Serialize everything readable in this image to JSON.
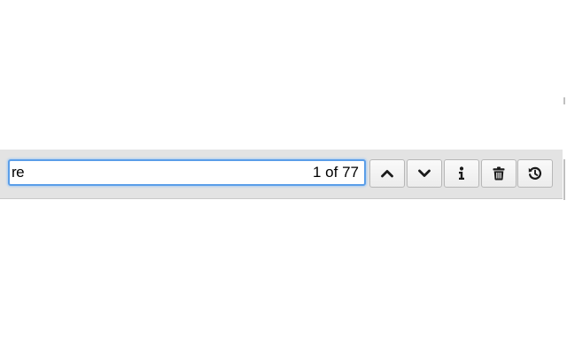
{
  "find_bar": {
    "query": "re",
    "match_count": "1 of 77",
    "buttons": [
      {
        "name": "previous-match-button",
        "icon": "chevron-up-icon"
      },
      {
        "name": "next-match-button",
        "icon": "chevron-down-icon"
      },
      {
        "name": "info-button",
        "icon": "info-icon"
      },
      {
        "name": "delete-button",
        "icon": "trash-icon"
      },
      {
        "name": "reset-button",
        "icon": "history-icon"
      }
    ]
  },
  "colors": {
    "bar_background": "#e3e3e3",
    "focus_ring": "#5b9ee8",
    "icon": "#1a1a1a"
  }
}
